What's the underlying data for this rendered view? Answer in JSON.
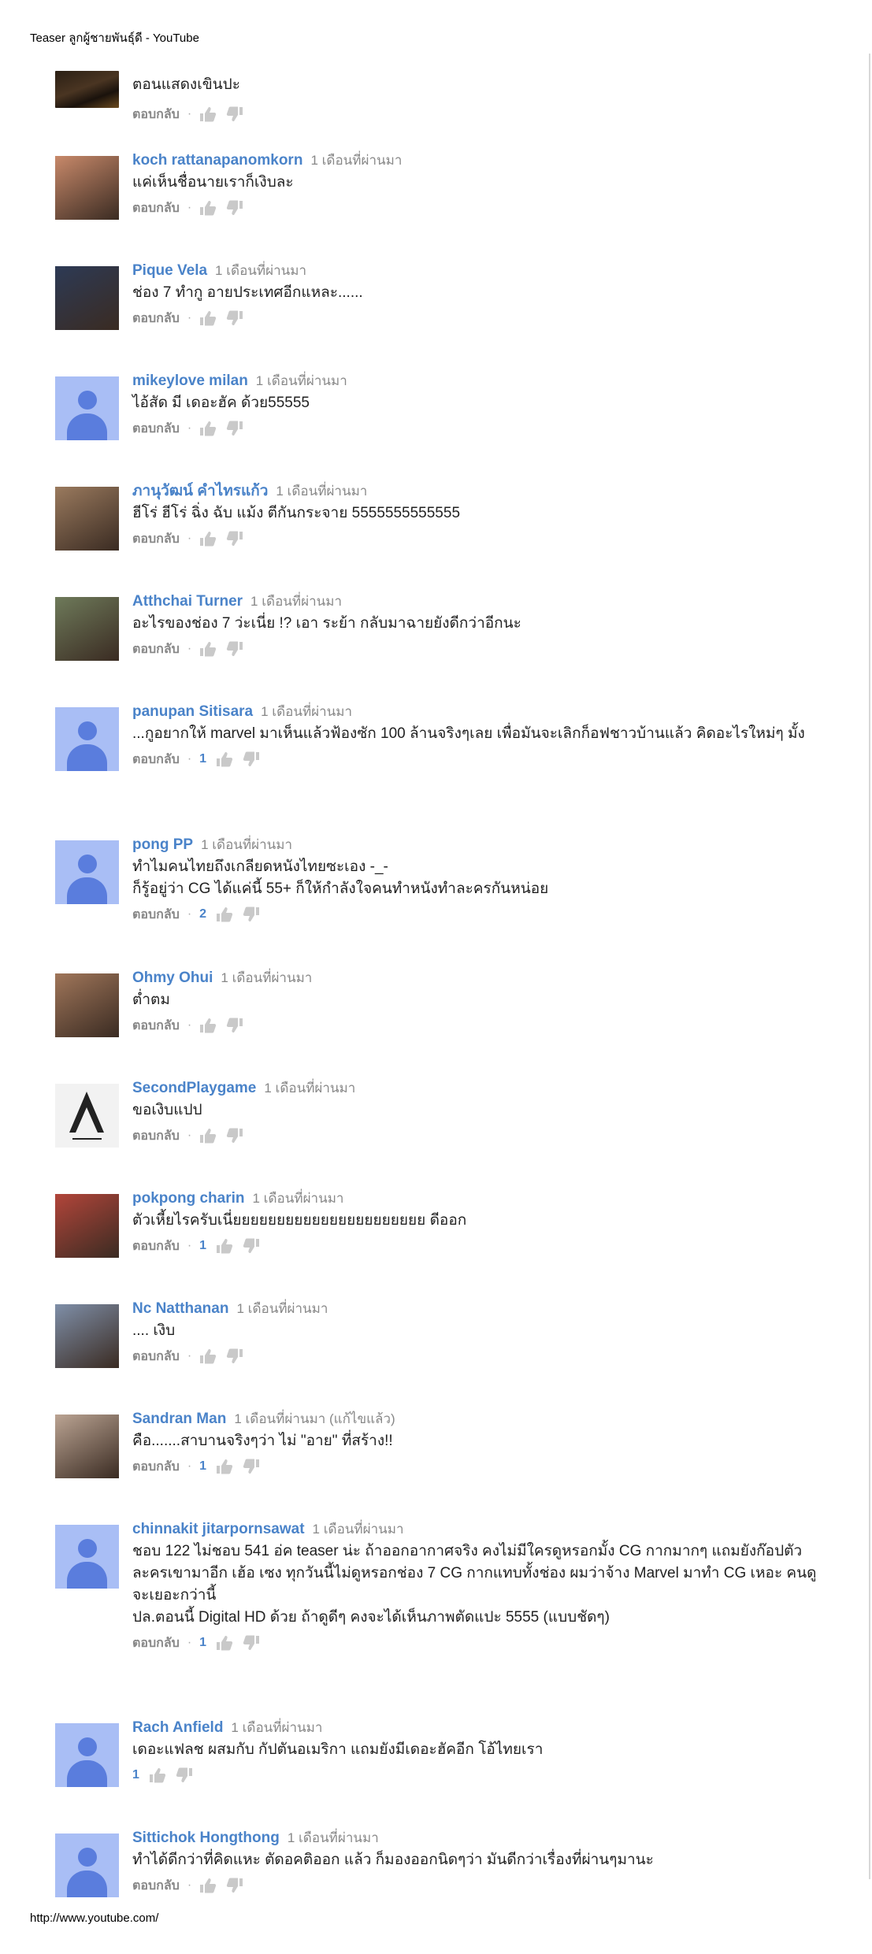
{
  "header": {
    "title": "Teaser ลูกผู้ชายพันธุ์ดี - YouTube"
  },
  "footer": {
    "url": "http://www.youtube.com/"
  },
  "labels": {
    "reply": "ตอบกลับ",
    "separator": "·"
  },
  "top_comment": {
    "text": "ตอนแสดงเขินปะ"
  },
  "comments": [
    {
      "author": "koch rattanapanomkorn",
      "time": "1 เดือนที่ผ่านมา",
      "text": "แค่เห็นชื่อนายเราก็เงิบละ",
      "likes": "",
      "avatar": "photo",
      "avatar_color": "#c8896a"
    },
    {
      "author": "Pique Vela",
      "time": "1 เดือนที่ผ่านมา",
      "text": "ช่อง 7 ทำกู อายประเทศอีกแหละ......",
      "likes": "",
      "avatar": "photo",
      "avatar_color": "#2d3a55"
    },
    {
      "author": "mikeylove milan",
      "time": "1 เดือนที่ผ่านมา",
      "text": "ไอ้สัด มี เดอะฮัค ด้วย55555",
      "likes": "",
      "avatar": "default"
    },
    {
      "author": "ภานุวัฒน์ คำไทรแก้ว",
      "time": "1 เดือนที่ผ่านมา",
      "text": "ฮีโร่ ฮีโร่ ฉิ่ง ฉับ แม้ง ตีกันกระจาย 5555555555555",
      "likes": "",
      "avatar": "photo",
      "avatar_color": "#9a7a5e"
    },
    {
      "author": "Atthchai Turner",
      "time": "1 เดือนที่ผ่านมา",
      "text": "อะไรของช่อง 7 ว่ะเนี่ย !? เอา ระย้า กลับมาฉายยังดีกว่าอีกนะ",
      "likes": "",
      "avatar": "photo",
      "avatar_color": "#6e7a5a"
    },
    {
      "author": "panupan Sitisara",
      "time": "1 เดือนที่ผ่านมา",
      "text": "...กูอยากให้ marvel มาเห็นแล้วฟ้องซัก 100 ล้านจริงๆเลย  เพื่อมันจะเลิกก็อฟชาวบ้านแล้ว คิดอะไรใหม่ๆ มั้ง",
      "likes": "1",
      "avatar": "default"
    },
    {
      "author": "pong PP",
      "time": "1 เดือนที่ผ่านมา",
      "text": "ทำไมคนไทยถึงเกลียดหนังไทยซะเอง -_-\nก็รู้อยู่ว่า CG ได้แค่นี้ 55+ ก็ให้กำลังใจคนทำหนังทำละครกันหน่อย",
      "likes": "2",
      "avatar": "default"
    },
    {
      "author": "Ohmy Ohui",
      "time": "1 เดือนที่ผ่านมา",
      "text": "ต่ำตม",
      "likes": "",
      "avatar": "photo",
      "avatar_color": "#a0765a"
    },
    {
      "author": "SecondPlaygame",
      "time": "1 เดือนที่ผ่านมา",
      "text": "ขอเงิบแปป",
      "likes": "",
      "avatar": "logo"
    },
    {
      "author": "pokpong charin",
      "time": "1 เดือนที่ผ่านมา",
      "text": "ตัวเหี้ยไรครับเนี่ยยยยยยยยยยยยยยยยยยยยยย ดีออก",
      "likes": "1",
      "avatar": "photo",
      "avatar_color": "#b2453a"
    },
    {
      "author": "Nc Natthanan",
      "time": "1 เดือนที่ผ่านมา",
      "text": ".... เงิบ",
      "likes": "",
      "avatar": "photo",
      "avatar_color": "#7f8fa8"
    },
    {
      "author": "Sandran Man",
      "time": "1 เดือนที่ผ่านมา (แก้ไขแล้ว)",
      "text": "คือ.......สาบานจริงๆว่า ไม่ \"อาย\" ที่สร้าง!!",
      "likes": "1",
      "avatar": "photo",
      "avatar_color": "#bba493"
    },
    {
      "author": "chinnakit jitarpornsawat",
      "time": "1 เดือนที่ผ่านมา",
      "text": "ชอบ 122 ไม่ชอบ 541 อ่ค teaser น่ะ ถ้าออกอากาศจริง คงไม่มีใครดูหรอกมั้ง CG กากมากๆ แถมยังก๊อปตัวละครเขามาอีก เฮ้อ เซง ทุกวันนี้ไม่ดูหรอกช่อง 7 CG กากแทบทั้งช่อง ผมว่าจ้าง Marvel มาทำ CG เหอะ คนดูจะเยอะกว่านี้\nปล.ตอนนี้ Digital HD ด้วย ถ้าดูดีๆ คงจะได้เห็นภาพตัดแปะ 5555 (แบบชัดๆ)",
      "likes": "1",
      "avatar": "default"
    },
    {
      "author": "Rach Anfield",
      "time": "1 เดือนที่ผ่านมา",
      "text": "เดอะแฟลช ผสมกับ กัปตันอเมริกา แถมยังมีเดอะฮัคอีก โอ้ไทยเรา",
      "likes": "1",
      "avatar": "default",
      "no_reply": true
    },
    {
      "author": "Sittichok Hongthong",
      "time": "1 เดือนที่ผ่านมา",
      "text": "ทำได้ดีกว่าที่คิดแหะ ตัดอคติออก แล้ว ก็มองออกนิดๆว่า มันดีกว่าเรื่องที่ผ่านๆมานะ",
      "likes": "",
      "avatar": "default"
    }
  ]
}
